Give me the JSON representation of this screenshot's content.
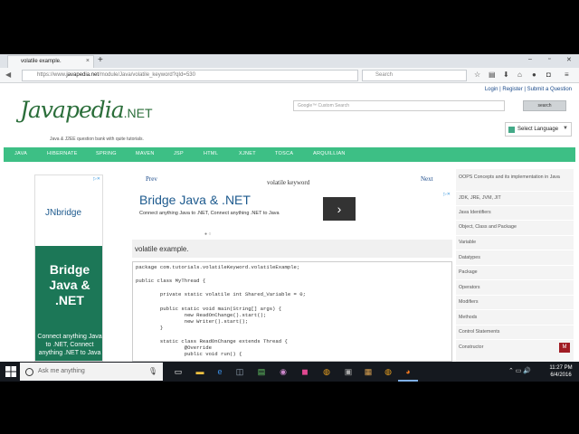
{
  "browser": {
    "tab_title": "volatile example.",
    "tab_close": "×",
    "new_tab": "+",
    "url_prefix": "https://www.",
    "url_domain": "javapedia.net",
    "url_path": "/module/Java/volatile_keyword?qId=530",
    "search_placeholder": "Search",
    "window_controls": [
      "–",
      "▫",
      "✕"
    ]
  },
  "page": {
    "top_links": "Login | Register | Submit a Question",
    "logo_main": "Javapedia",
    "logo_suffix": ".NET",
    "tagline": "Java & J2EE question bank with quite tutorials.",
    "google_search_placeholder": "Google™ Custom Search",
    "google_search_button": "search",
    "language_select": "Select Language",
    "nav": [
      "JAVA",
      "HIBERNATE",
      "SPRING",
      "MAVEN",
      "JSP",
      "HTML",
      "XJNET",
      "TOSCA",
      "ARQUILLIAN"
    ],
    "prev_label": "Prev",
    "next_label": "Next",
    "keyword_heading": "volatile keyword",
    "content_title": "volatile example.",
    "code_lines": [
      "package com.tutorials.volatileKeyword.volatileExample;",
      "public class MyThread {",
      "        private static volatile int Shared_Variable = 0;",
      "        public static void main(String[] args) {",
      "                new ReadOnChange().start();",
      "                new Writer().start();",
      "        }",
      "        static class ReadOnChange extends Thread {",
      "                @Override",
      "                public void run() {"
    ],
    "sidebar": [
      "OOPS Concepts and its implementation in Java",
      "JDK, JRE, JVM, JIT",
      "Java Identifiers",
      "Object, Class and Package",
      "Variable",
      "Datatypes",
      "Package",
      "Operators",
      "Modifiers",
      "Methods",
      "Control Statements",
      "Constructor"
    ]
  },
  "ads": {
    "left_logo": "JNbridge",
    "left_big": "Bridge Java & .NET",
    "left_small": "Connect anything Java to .NET, Connect anything .NET to Java",
    "mid_headline": "Bridge Java & .NET",
    "mid_sub": "Connect anything Java to .NET, Connect anything .NET to Java",
    "mid_arrow": "›",
    "adchoice": "▷✕"
  },
  "taskbar": {
    "search_placeholder": "Ask me anything",
    "time": "11:27 PM",
    "date": "6/4/2016"
  }
}
